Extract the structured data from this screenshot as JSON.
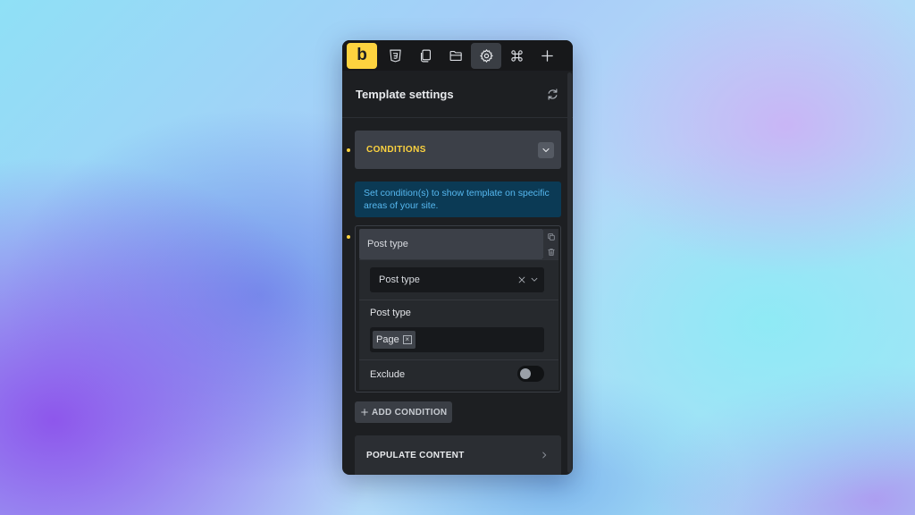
{
  "toolbar": {
    "logo_letter": "b",
    "buttons": [
      {
        "icon": "css3-icon"
      },
      {
        "icon": "pages-icon"
      },
      {
        "icon": "folder-icon"
      },
      {
        "icon": "gear-icon",
        "active": true
      },
      {
        "icon": "command-icon"
      },
      {
        "icon": "plus-icon"
      }
    ]
  },
  "header": {
    "title": "Template settings",
    "icon": "refresh-icon"
  },
  "conditions": {
    "section_title": "CONDITIONS",
    "info_text": "Set condition(s) to show template on specific areas of your site.",
    "condition_title": "Post type",
    "select_value": "Post type",
    "control_label": "Post type",
    "tags": [
      "Page"
    ],
    "exclude_label": "Exclude",
    "exclude_on": false,
    "add_label": "ADD CONDITION"
  },
  "populate": {
    "title": "POPULATE CONTENT"
  },
  "colors": {
    "accent": "#fdd33f",
    "panel": "#1d1f22",
    "info_text": "#56b8f0",
    "info_bg": "#0b3a55"
  }
}
